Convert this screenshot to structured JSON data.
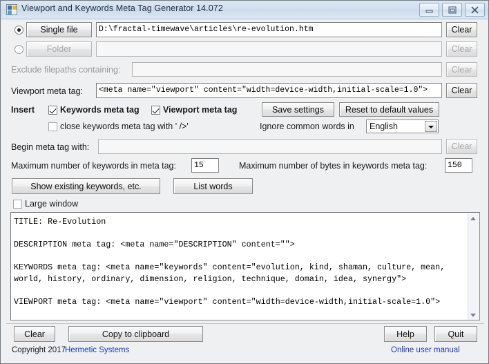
{
  "window": {
    "title": "Viewport and Keywords Meta Tag Generator 14.072",
    "icon": "app-icon",
    "minimize": "minimize-icon",
    "maximize": "maximize-icon",
    "close": "close-icon"
  },
  "source": {
    "single_file_label": "Single file",
    "single_file_selected": true,
    "single_file_path": "D:\\fractal-timewave\\articles\\re-evolution.htm",
    "single_file_clear": "Clear",
    "folder_label": "Folder",
    "folder_selected": false,
    "folder_path": "",
    "folder_clear": "Clear"
  },
  "exclude": {
    "label": "Exclude filepaths containing:",
    "value": "",
    "clear": "Clear"
  },
  "viewport": {
    "label": "Viewport meta tag:",
    "value": "<meta name=\"viewport\" content=\"width=device-width,initial-scale=1.0\">",
    "clear": "Clear"
  },
  "insert": {
    "label": "Insert",
    "keywords_meta_tag": "Keywords meta tag",
    "keywords_meta_tag_checked": true,
    "viewport_meta_tag": "Viewport meta tag",
    "viewport_meta_tag_checked": true,
    "close_keywords": "close keywords meta tag with ' />'",
    "close_keywords_checked": false
  },
  "settings": {
    "save_settings": "Save settings",
    "reset_defaults": "Reset to default values",
    "ignore_common_words_label": "Ignore common words in",
    "language_selected": "English",
    "language_options": [
      "English"
    ]
  },
  "begin": {
    "label": "Begin meta tag with:",
    "value": "",
    "clear": "Clear"
  },
  "limits": {
    "max_keywords_label": "Maximum number of keywords in meta tag:",
    "max_keywords_value": "15",
    "max_bytes_label": "Maximum number of bytes in keywords meta tag:",
    "max_bytes_value": "150"
  },
  "actions": {
    "show_existing": "Show existing keywords, etc.",
    "list_words": "List words",
    "large_window": "Large window",
    "large_window_checked": false
  },
  "output": {
    "text": "TITLE: Re-Evolution\n\nDESCRIPTION meta tag: <meta name=\"DESCRIPTION\" content=\"\">\n\nKEYWORDS meta tag: <meta name=\"keywords\" content=\"evolution, kind, shaman, culture, mean,\nworld, history, ordinary, dimension, religion, technique, domain, idea, synergy\">\n\nVIEWPORT meta tag: <meta name=\"viewport\" content=\"width=device-width,initial-scale=1.0\">",
    "scroll_up": "scroll-up-icon",
    "scroll_down": "scroll-down-icon"
  },
  "footer": {
    "clear": "Clear",
    "copy_to_clipboard": "Copy to clipboard",
    "help": "Help",
    "quit": "Quit",
    "copyright": "Copyright 2017",
    "company": "Hermetic Systems",
    "online_manual": "Online user manual"
  }
}
